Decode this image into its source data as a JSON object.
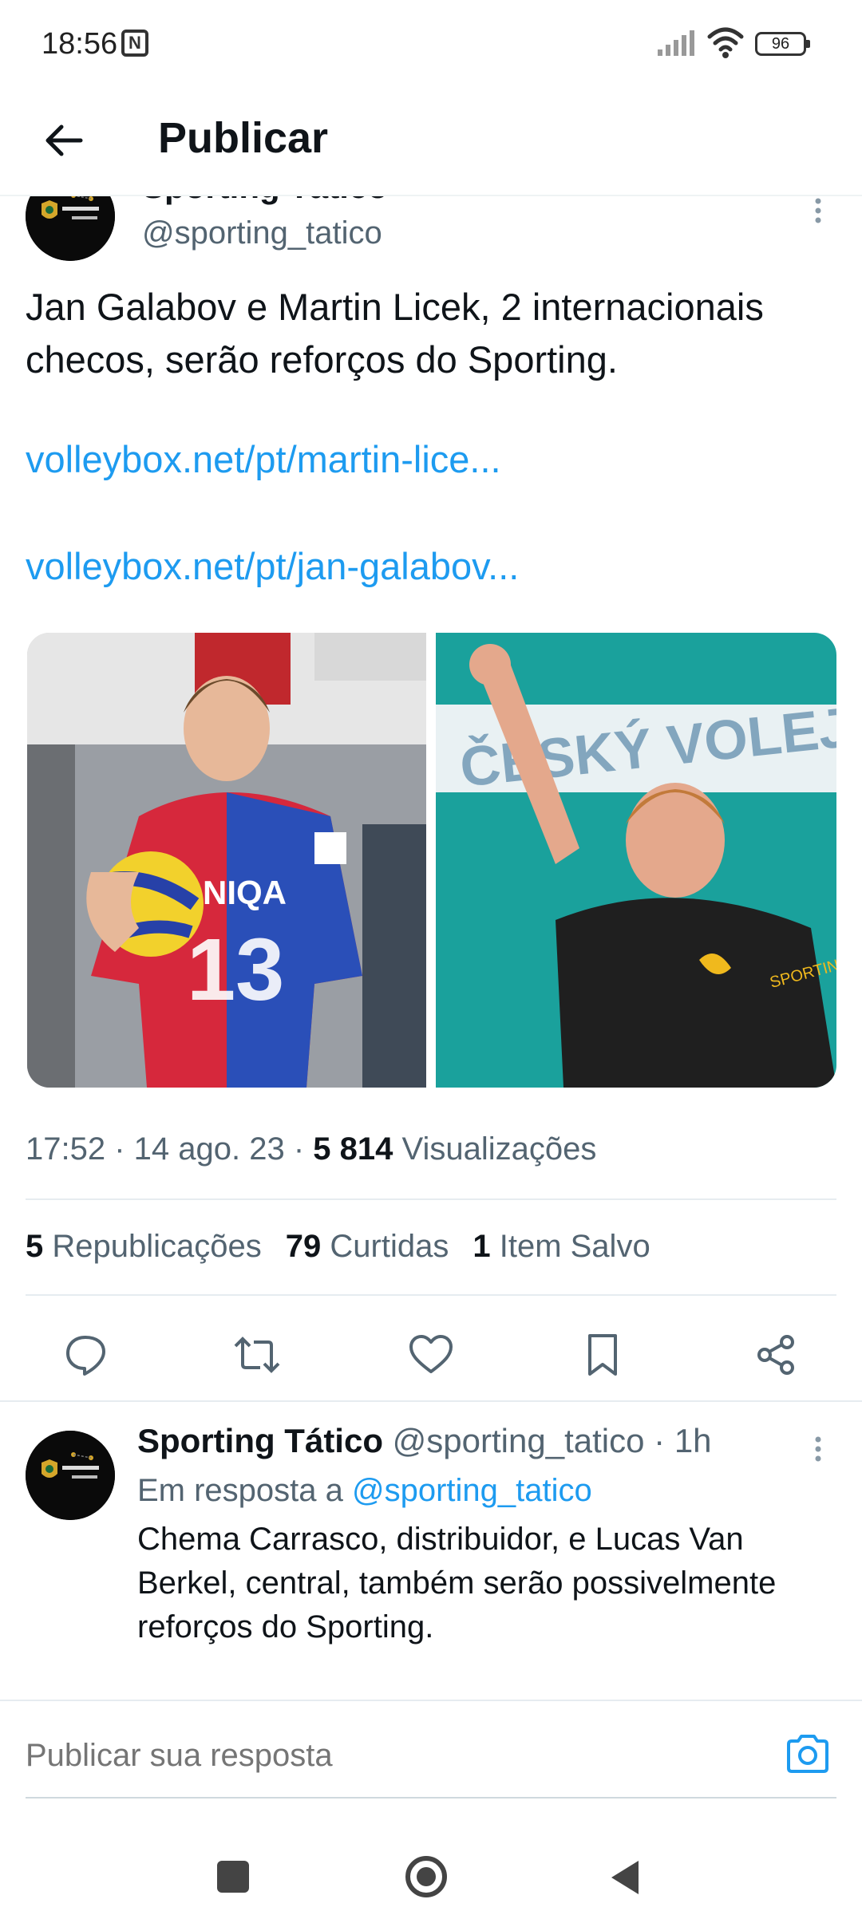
{
  "status_bar": {
    "time": "18:56",
    "nfc_icon": "N",
    "battery_level": "96"
  },
  "header": {
    "title": "Publicar"
  },
  "post": {
    "author_name": "Sporting Tático",
    "handle": "@sporting_tatico",
    "text": "Jan Galabov e Martin Licek, 2 internacionais checos, serão reforços do Sporting.",
    "link_1": "volleybox.net/pt/martin-lice...",
    "link_2": "volleybox.net/pt/jan-galabov...",
    "time": "17:52",
    "date": "14 ago. 23",
    "views_count": "5 814",
    "views_label": "Visualizações",
    "reposts_count": "5",
    "reposts_label": "Republicações",
    "likes_count": "79",
    "likes_label": "Curtidas",
    "saves_count": "1",
    "saves_label": "Item Salvo",
    "media": [
      {
        "description": "volleyball-player-red-blue-jersey"
      },
      {
        "description": "volleyball-player-black-jersey"
      }
    ]
  },
  "actions": [
    "reply-icon",
    "repost-icon",
    "like-icon",
    "bookmark-icon",
    "share-icon"
  ],
  "reply": {
    "author_name": "Sporting Tático",
    "handle": "@sporting_tatico",
    "time": "1h",
    "context_prefix": "Em resposta a",
    "context_handle": "@sporting_tatico",
    "text": "Chema Carrasco, distribuidor, e Lucas Van Berkel, central, também serão possivelmente reforços do Sporting."
  },
  "composer": {
    "placeholder": "Publicar sua resposta"
  },
  "colors": {
    "link": "#1d9bf0",
    "secondary_text": "#536471",
    "primary_text": "#0f1419"
  }
}
